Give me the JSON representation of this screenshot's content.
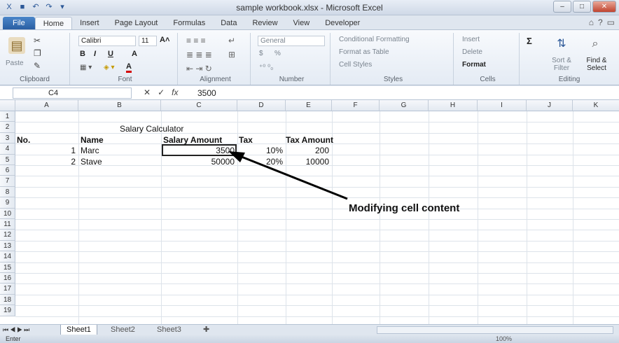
{
  "window": {
    "title": "sample workbook.xlsx - Microsoft Excel"
  },
  "tabs": [
    "File",
    "Home",
    "Insert",
    "Page Layout",
    "Formulas",
    "Data",
    "Review",
    "View",
    "Developer"
  ],
  "ribbon": {
    "clipboard": {
      "paste": "Paste",
      "label": "Clipboard"
    },
    "font": {
      "name": "Calibri",
      "size": "11",
      "bold": "B",
      "italic": "I",
      "underline": "U",
      "label": "Font"
    },
    "alignment": {
      "label": "Alignment"
    },
    "number": {
      "format": "General",
      "currency": "$",
      "percent": "%",
      "label": "Number"
    },
    "styles": {
      "conditional": "Conditional Formatting",
      "table": "Format as Table",
      "cell_styles": "Cell Styles",
      "label": "Styles"
    },
    "cells": {
      "insert": "Insert",
      "delete": "Delete",
      "format": "Format",
      "label": "Cells"
    },
    "editing": {
      "sum": "Σ",
      "sort": "Sort & Filter",
      "find": "Find & Select",
      "label": "Editing"
    }
  },
  "formula_bar": {
    "cell_ref": "C4",
    "formula": "3500",
    "fx": "fx"
  },
  "columns": [
    "A",
    "B",
    "C",
    "D",
    "E",
    "F",
    "G",
    "H",
    "I",
    "J",
    "K"
  ],
  "rows": [
    "1",
    "2",
    "3",
    "4",
    "5",
    "6",
    "7",
    "8",
    "9",
    "10",
    "11",
    "12",
    "13",
    "14",
    "15",
    "16",
    "17",
    "18",
    "19"
  ],
  "cells": {
    "title": "Salary Calculator",
    "h_no": "No.",
    "h_name": "Name",
    "h_salary": "Salary Amount",
    "h_tax": "Tax",
    "h_taxamt": "Tax Amount",
    "r4_no": "1",
    "r4_name": "Marc",
    "r4_salary": "3500",
    "r4_tax": "10%",
    "r4_taxamt": "200",
    "r5_no": "2",
    "r5_name": "Stave",
    "r5_salary": "50000",
    "r5_tax": "20%",
    "r5_taxamt": "10000"
  },
  "annotation": "Modifying cell content",
  "sheets": [
    "Sheet1",
    "Sheet2",
    "Sheet3"
  ],
  "status": {
    "mode": "Enter",
    "zoom": "100%"
  }
}
